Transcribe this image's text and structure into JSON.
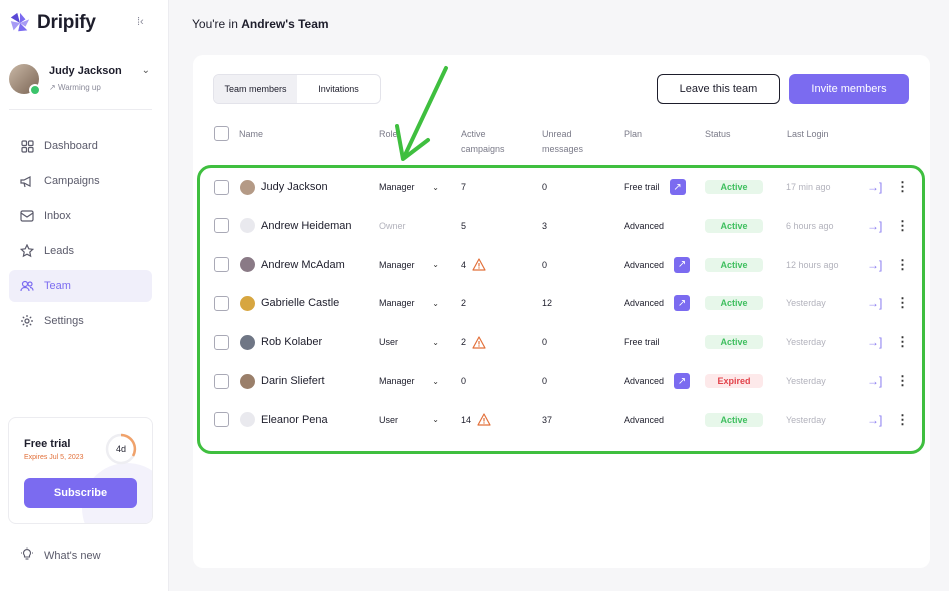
{
  "brand": {
    "name": "Dripify",
    "accent": "#7b6bf0"
  },
  "user": {
    "name": "Judy Jackson",
    "status": "Warming up"
  },
  "nav": {
    "items": [
      {
        "label": "Dashboard",
        "icon": "dashboard-icon"
      },
      {
        "label": "Campaigns",
        "icon": "megaphone-icon"
      },
      {
        "label": "Inbox",
        "icon": "inbox-icon"
      },
      {
        "label": "Leads",
        "icon": "leads-icon"
      },
      {
        "label": "Team",
        "icon": "team-icon",
        "active": true
      },
      {
        "label": "Settings",
        "icon": "gear-icon"
      }
    ]
  },
  "trial": {
    "title": "Free trial",
    "expires": "Expires Jul 5, 2023",
    "days_left": "4d",
    "subscribe_label": "Subscribe"
  },
  "whats_new": "What's new",
  "header": {
    "prefix": "You're in",
    "team": "Andrew's Team"
  },
  "tabs": [
    {
      "label": "Team members",
      "active": true
    },
    {
      "label": "Invitations"
    }
  ],
  "buttons": {
    "leave": "Leave this team",
    "invite": "Invite members"
  },
  "columns": {
    "name": "Name",
    "role": "Role",
    "active_campaigns_1": "Active",
    "active_campaigns_2": "campaigns",
    "unread_1": "Unread",
    "unread_2": "messages",
    "plan": "Plan",
    "status": "Status",
    "last_login": "Last Login"
  },
  "members": [
    {
      "name": "Judy Jackson",
      "role": "Manager",
      "role_dropdown": true,
      "campaigns": "7",
      "warn": false,
      "unread": "0",
      "plan": "Free trail",
      "upgrade": true,
      "status": "Active",
      "last_login": "17 min ago",
      "avatar_color": "#b49a86"
    },
    {
      "name": "Andrew Heideman",
      "role": "Owner",
      "role_dropdown": false,
      "campaigns": "5",
      "warn": false,
      "unread": "3",
      "plan": "Advanced",
      "upgrade": false,
      "status": "Active",
      "last_login": "6 hours ago",
      "avatar_color": "#e9e9ee"
    },
    {
      "name": "Andrew McAdam",
      "role": "Manager",
      "role_dropdown": true,
      "campaigns": "4",
      "warn": true,
      "unread": "0",
      "plan": "Advanced",
      "upgrade": true,
      "status": "Active",
      "last_login": "12 hours ago",
      "avatar_color": "#8a7a86"
    },
    {
      "name": "Gabrielle Castle",
      "role": "Manager",
      "role_dropdown": true,
      "campaigns": "2",
      "warn": false,
      "unread": "12",
      "plan": "Advanced",
      "upgrade": true,
      "status": "Active",
      "last_login": "Yesterday",
      "avatar_color": "#d7a640"
    },
    {
      "name": "Rob Kolaber",
      "role": "User",
      "role_dropdown": true,
      "campaigns": "2",
      "warn": true,
      "unread": "0",
      "plan": "Free trail",
      "upgrade": false,
      "status": "Active",
      "last_login": "Yesterday",
      "avatar_color": "#6f7685"
    },
    {
      "name": "Darin Sliefert",
      "role": "Manager",
      "role_dropdown": true,
      "campaigns": "0",
      "warn": false,
      "unread": "0",
      "plan": "Advanced",
      "upgrade": true,
      "status": "Expired",
      "last_login": "Yesterday",
      "avatar_color": "#9a7f6a"
    },
    {
      "name": "Eleanor Pena",
      "role": "User",
      "role_dropdown": true,
      "campaigns": "14",
      "warn": true,
      "unread": "37",
      "plan": "Advanced",
      "upgrade": false,
      "status": "Active",
      "last_login": "Yesterday",
      "avatar_color": "#e9e9ee"
    }
  ],
  "annotation_color": "#3fbf3f"
}
